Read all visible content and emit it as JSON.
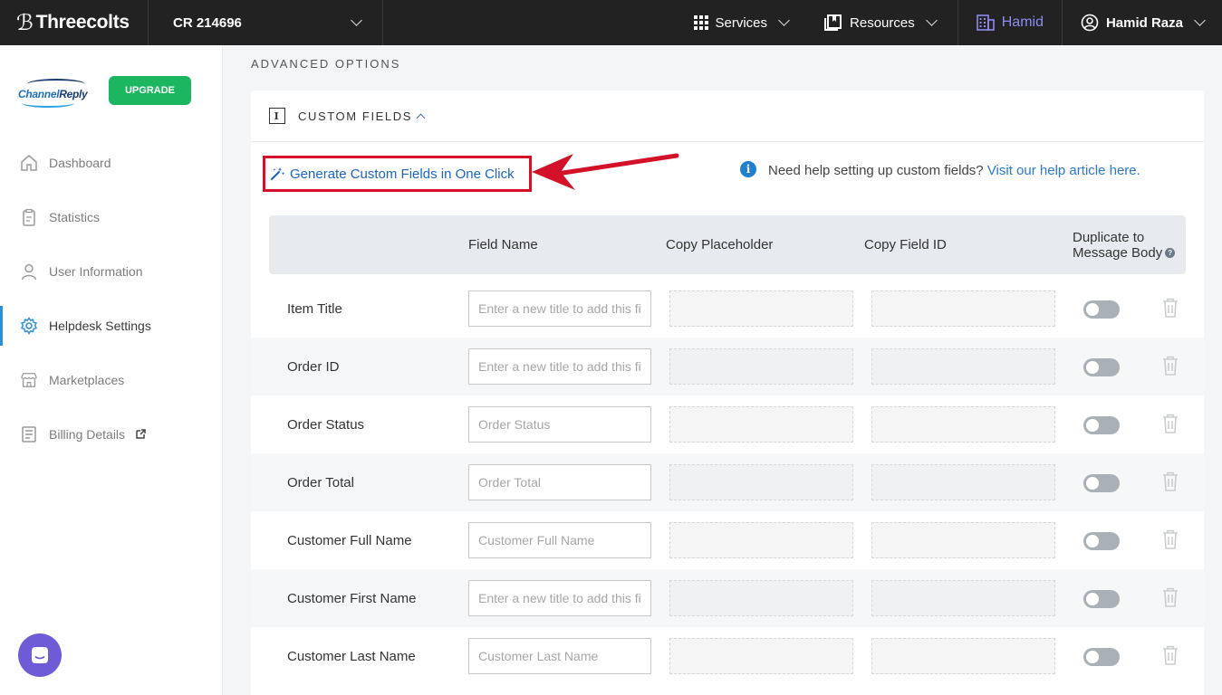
{
  "topbar": {
    "brand": "Threecolts",
    "account": "CR 214696",
    "services_label": "Services",
    "resources_label": "Resources",
    "org_label": "Hamid",
    "user_label": "Hamid Raza"
  },
  "sidebar": {
    "logo_text_a": "Channel",
    "logo_text_b": "Reply",
    "upgrade_label": "UPGRADE",
    "items": [
      {
        "label": "Dashboard"
      },
      {
        "label": "Statistics"
      },
      {
        "label": "User Information"
      },
      {
        "label": "Helpdesk Settings"
      },
      {
        "label": "Marketplaces"
      },
      {
        "label": "Billing Details"
      }
    ]
  },
  "main": {
    "section_label": "ADVANCED OPTIONS",
    "card_title": "CUSTOM FIELDS",
    "generate_link": "Generate Custom Fields in One Click",
    "help_text": "Need help setting up custom fields?",
    "help_link": "Visit our help article here.",
    "columns": {
      "field_name": "Field Name",
      "copy_placeholder": "Copy Placeholder",
      "copy_field_id": "Copy Field ID",
      "duplicate": "Duplicate to Message Body"
    },
    "rows": [
      {
        "label": "Item Title",
        "placeholder": "Enter a new title to add this field"
      },
      {
        "label": "Order ID",
        "placeholder": "Enter a new title to add this field"
      },
      {
        "label": "Order Status",
        "placeholder": "Order Status"
      },
      {
        "label": "Order Total",
        "placeholder": "Order Total"
      },
      {
        "label": "Customer Full Name",
        "placeholder": "Customer Full Name"
      },
      {
        "label": "Customer First Name",
        "placeholder": "Enter a new title to add this field"
      },
      {
        "label": "Customer Last Name",
        "placeholder": "Customer Last Name"
      }
    ],
    "duplicate_enabled": [
      false,
      false,
      false,
      false,
      false,
      false,
      false
    ]
  }
}
